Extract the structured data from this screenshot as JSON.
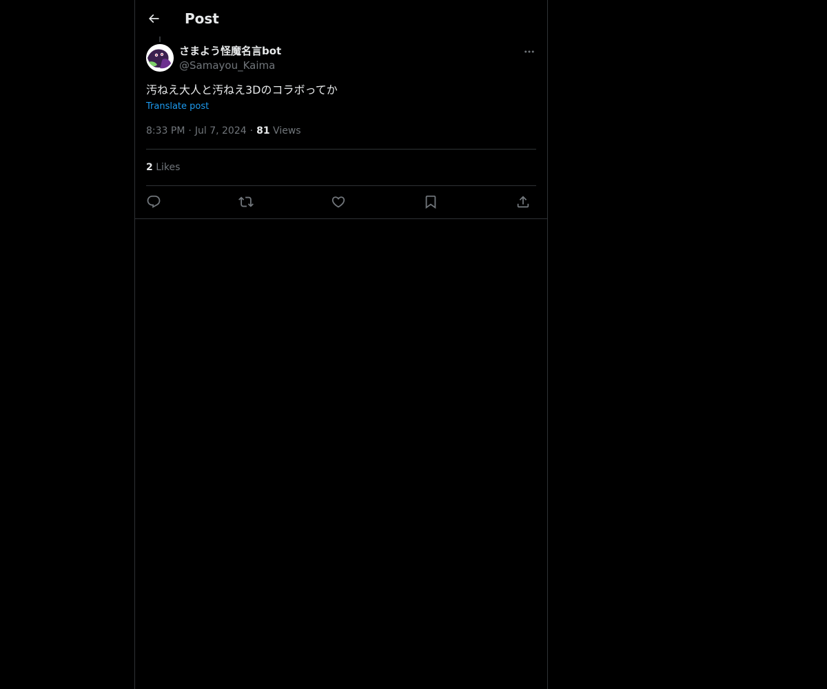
{
  "header": {
    "title": "Post"
  },
  "post": {
    "author": {
      "display_name": "さまよう怪魔名言bot",
      "handle": "@Samayou_Kaima"
    },
    "text": "汚ねえ大人と汚ねえ3Dのコラボってか",
    "translate_label": "Translate post",
    "time": "8:33 PM",
    "date": "Jul 7, 2024",
    "separator": "·",
    "views_count": "81",
    "views_label": "Views",
    "likes_count": "2",
    "likes_label": "Likes"
  },
  "icons": {
    "back": "arrow-left-icon",
    "more": "more-dots-icon",
    "reply": "reply-bubble-icon",
    "repost": "repost-arrows-icon",
    "like": "heart-icon",
    "bookmark": "bookmark-icon",
    "share": "share-upload-icon"
  },
  "colors": {
    "background": "#000000",
    "text_primary": "#e7e9ea",
    "text_secondary": "#71767b",
    "accent": "#1d9bf0",
    "border": "#2f3336"
  }
}
